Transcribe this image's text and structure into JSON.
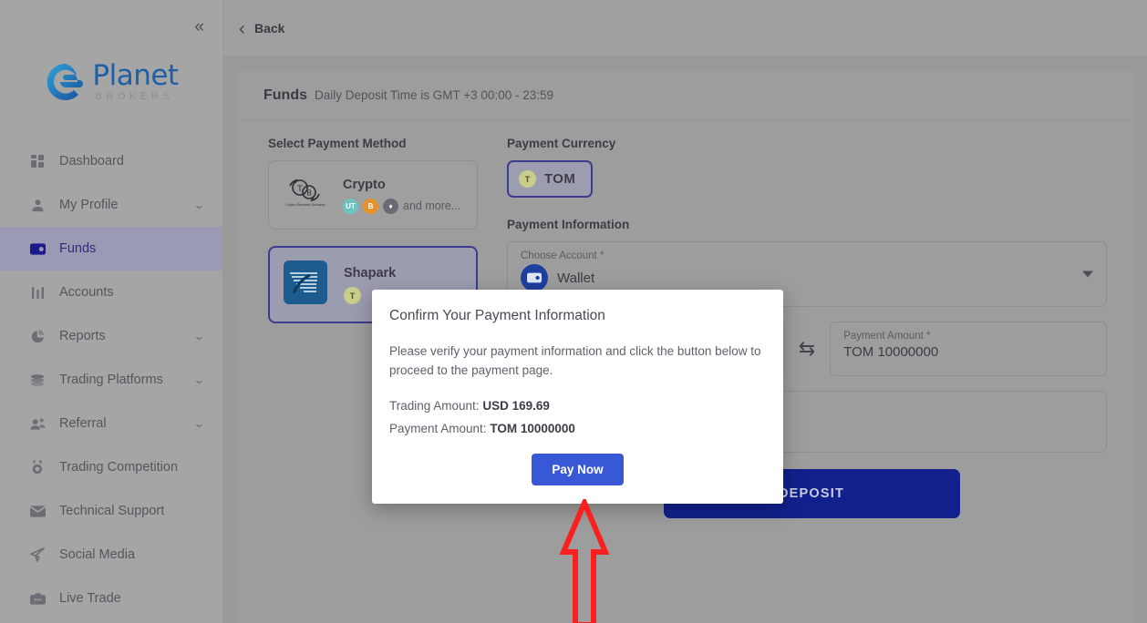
{
  "brand": {
    "name_primary": "Planet",
    "name_secondary": "BROKERS",
    "accent_blue": "#1f5fa6"
  },
  "sidebar": {
    "collapse_icon": "«",
    "items": [
      {
        "label": "Dashboard",
        "icon": "grid-icon",
        "chevron": "",
        "active": false
      },
      {
        "label": "My Profile",
        "icon": "user-icon",
        "chevron": "⌄",
        "active": false
      },
      {
        "label": "Funds",
        "icon": "wallet-icon",
        "chevron": "",
        "active": true
      },
      {
        "label": "Accounts",
        "icon": "sliders-icon",
        "chevron": "",
        "active": false
      },
      {
        "label": "Reports",
        "icon": "pie-chart-icon",
        "chevron": "⌄",
        "active": false
      },
      {
        "label": "Trading Platforms",
        "icon": "layers-icon",
        "chevron": "⌄",
        "active": false
      },
      {
        "label": "Referral",
        "icon": "users-icon",
        "chevron": "⌄",
        "active": false
      },
      {
        "label": "Trading Competition",
        "icon": "medal-icon",
        "chevron": "",
        "active": false
      },
      {
        "label": "Technical Support",
        "icon": "envelope-icon",
        "chevron": "",
        "active": false
      },
      {
        "label": "Social Media",
        "icon": "paper-plane-icon",
        "chevron": "",
        "active": false
      },
      {
        "label": "Live Trade",
        "icon": "briefcase-icon",
        "chevron": "",
        "active": false
      }
    ]
  },
  "topbar": {
    "back_label": "Back",
    "back_icon": "chevron-left-icon"
  },
  "funds": {
    "title": "Funds",
    "subtitle": "Daily Deposit Time is GMT +3 00:00 - 23:59"
  },
  "payment_method": {
    "section_title": "Select Payment Method",
    "options": [
      {
        "name": "Crypto",
        "logo": "crypto-payment-gateway-logo",
        "coins": [
          "UT",
          "B",
          "♦"
        ],
        "more_text": "and more...",
        "selected": false
      },
      {
        "name": "Shapark",
        "logo": "shapark-logo",
        "coins": [
          "T"
        ],
        "more_text": "",
        "selected": true
      }
    ]
  },
  "payment_currency": {
    "section_title": "Payment Currency",
    "selected": {
      "code": "TOM",
      "badge": "T"
    }
  },
  "payment_information": {
    "section_title": "Payment Information",
    "account_field": {
      "label": "Choose Account *",
      "value": "Wallet",
      "avatar_icon": "wallet-avatar-icon",
      "dropdown_icon": "caret-down-icon"
    },
    "swap_icon": "swap-arrows-icon",
    "payment_amount_field": {
      "label": "Payment Amount *",
      "value": "TOM 10000000"
    },
    "deposit_button": "DEPOSIT"
  },
  "modal": {
    "title": "Confirm Your Payment Information",
    "paragraph": "Please verify your payment information and click the button below to proceed to the payment page.",
    "trading_amount_label": "Trading Amount:",
    "trading_amount_value": "USD 169.69",
    "payment_amount_label": "Payment Amount:",
    "payment_amount_value": "TOM 10000000",
    "pay_button": "Pay Now",
    "pay_button_color": "#3958d6"
  },
  "annotation": {
    "arrow_icon": "red-up-arrow-annotation",
    "color": "#fa2020"
  }
}
